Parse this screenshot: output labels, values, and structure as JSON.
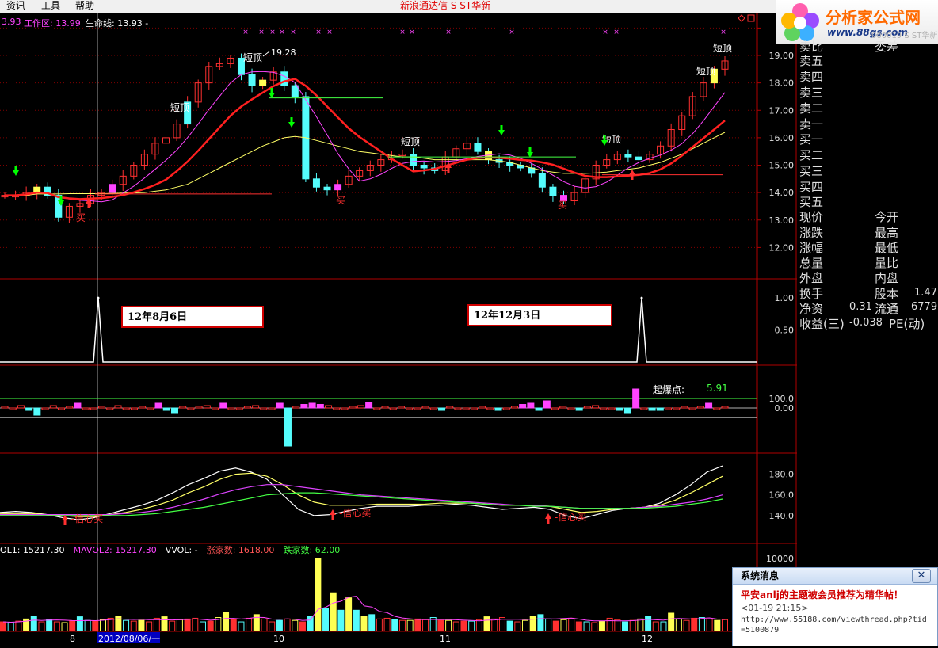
{
  "menu": {
    "items": [
      "资讯",
      "工具",
      "帮助"
    ],
    "title": "新浪通达信  S ST华新"
  },
  "logo": {
    "brand": "分析家公式网",
    "url": "www.88gs.com",
    "overlay": "000019 S ST华新"
  },
  "indicators": {
    "price_prefix": "3.93",
    "work_label": "工作区: 13.99",
    "life_label": "生命线: 13.93 -",
    "vol_items": [
      {
        "text": "OL1: 15217.30",
        "color": "#ffffff"
      },
      {
        "text": "MAVOL2: 15217.30",
        "color": "#ff44ff"
      },
      {
        "text": "VVOL: -",
        "color": "#ffffff"
      },
      {
        "text": "涨家数: 1618.00",
        "color": "#ff5555"
      },
      {
        "text": "跌家数: 62.00",
        "color": "#44ff44"
      }
    ]
  },
  "chart_annotations": {
    "high_price": "19.28",
    "short_top": "短顶",
    "buy": "买",
    "confidence_buy": "信心买",
    "callout_left": "12年8月6日",
    "callout_right": "12年12月3日",
    "burst_label": "起爆点:",
    "burst_value": "5.91"
  },
  "axis": {
    "price_ticks": [
      "20",
      "19.00",
      "18.00",
      "17.00",
      "16.00",
      "15.00",
      "14.00",
      "13.00",
      "12.00"
    ],
    "signal_ticks": [
      "1.00",
      "0.50"
    ],
    "osc_ticks": [
      "100.0",
      "0.00"
    ],
    "ma_ticks": [
      "180.0",
      "160.0",
      "140.0"
    ],
    "vol_ticks": [
      "10000"
    ],
    "date_labels": [
      "8",
      "2012/08/06/一",
      "10",
      "11",
      "12"
    ]
  },
  "sidebar": {
    "header_partial": [
      "卖比",
      "委差"
    ],
    "sell_levels": [
      "卖五",
      "卖四",
      "卖三",
      "卖二",
      "卖一"
    ],
    "buy_levels": [
      "买一",
      "买二",
      "买三",
      "买四",
      "买五"
    ],
    "stats_left": [
      "现价",
      "涨跌",
      "涨幅",
      "总量",
      "外盘",
      "换手",
      "净资",
      "收益(三)"
    ],
    "stats_right": [
      "今开",
      "最高",
      "最低",
      "量比",
      "内盘",
      "股本",
      "流通",
      "PE(动)"
    ],
    "values": {
      "turnover_equity": "1.47",
      "net_asset": "0.31",
      "float": "6779",
      "eps": "-0.038"
    }
  },
  "popup": {
    "title": "系统消息",
    "headline": "平安anlj的主题被会员推荐为精华帖！",
    "time": "<01-19 21:15>",
    "link": "http://www.55188.com/viewthread.php?tid=5100879"
  },
  "colors": {
    "up": "#ff3030",
    "down": "#54fcfc",
    "magenta": "#ff44ff",
    "yellow": "#ffff54",
    "grid": "#800000",
    "green_arrow": "#00ff00"
  },
  "chart_data": [
    {
      "type": "candlestick",
      "title": "",
      "ylim": [
        11.0,
        20.3
      ],
      "series": [
        {
          "name": "price_close",
          "values": [
            13.9,
            13.9,
            14.0,
            14.2,
            13.9,
            13.1,
            13.5,
            13.6,
            13.9,
            14.0,
            14.3,
            14.6,
            15.0,
            15.4,
            15.8,
            16.0,
            16.5,
            17.3,
            18.0,
            18.6,
            18.7,
            18.9,
            18.3,
            17.9,
            18.1,
            18.4,
            17.9,
            17.5,
            14.5,
            14.2,
            14.1,
            14.3,
            14.6,
            14.8,
            15.0,
            15.2,
            15.4,
            15.4,
            15.0,
            14.9,
            14.8,
            15.3,
            15.6,
            15.8,
            15.5,
            15.2,
            15.1,
            15.0,
            14.9,
            14.7,
            14.2,
            13.9,
            13.7,
            14.0,
            14.5,
            15.0,
            15.2,
            15.4,
            15.3,
            15.2,
            15.4,
            15.7,
            16.3,
            16.8,
            17.5,
            18.0,
            18.5,
            18.8
          ]
        },
        {
          "name": "life_line",
          "values": [
            13.9,
            13.9,
            13.9,
            13.95,
            13.95,
            13.95,
            13.96,
            13.96,
            13.96,
            13.96,
            13.97,
            13.98,
            13.99,
            14.0,
            14.05,
            14.1,
            14.2,
            14.3,
            14.5,
            14.7,
            14.9,
            15.1,
            15.3,
            15.5,
            15.7,
            15.85,
            16.0,
            16.05,
            16.0,
            15.9,
            15.8,
            15.7,
            15.6,
            15.5,
            15.45,
            15.4,
            15.35,
            15.3,
            15.3,
            15.25,
            15.2,
            15.2,
            15.2,
            15.2,
            15.2,
            15.2,
            15.15,
            15.1,
            15.0,
            14.9,
            14.8,
            14.75,
            14.7,
            14.7,
            14.7,
            14.72,
            14.75,
            14.8,
            14.85,
            14.9,
            15.0,
            15.1,
            15.25,
            15.4,
            15.6,
            15.8,
            16.0,
            16.2
          ]
        }
      ]
    },
    {
      "type": "line",
      "title": "",
      "ylim": [
        0,
        1.15
      ],
      "x": [
        "2012-08-06",
        "2012-12-03"
      ],
      "values": [
        1.0,
        1.0
      ]
    },
    {
      "type": "bar",
      "title": "",
      "ylim": [
        -180,
        110
      ],
      "values": [
        5,
        -5,
        10,
        -10,
        -30,
        -5,
        10,
        -5,
        5,
        20,
        -5,
        -5,
        5,
        -5,
        10,
        -5,
        -5,
        5,
        -5,
        20,
        -10,
        -20,
        5,
        -5,
        5,
        10,
        -5,
        20,
        -5,
        -5,
        5,
        10,
        -5,
        -5,
        20,
        -160,
        5,
        15,
        20,
        15,
        10,
        -5,
        -5,
        5,
        10,
        25,
        -5,
        5,
        -5,
        5,
        -5,
        -5,
        5,
        -5,
        -10,
        5,
        -5,
        -5,
        -5,
        5,
        -5,
        -10,
        -5,
        5,
        15,
        20,
        -10,
        30,
        -5,
        5,
        -5,
        -10,
        5,
        10,
        -5,
        -5,
        -10,
        -20,
        80,
        -5,
        -10,
        -10,
        -5,
        -5,
        5,
        -5,
        5,
        20,
        -5,
        5
      ],
      "annotation": "起爆点: 5.91"
    },
    {
      "type": "line",
      "title": "",
      "ylim": [
        120,
        195
      ],
      "series": [
        {
          "name": "white",
          "values": [
            143,
            144,
            143,
            141,
            138,
            136,
            138,
            142,
            146,
            150,
            155,
            162,
            170,
            176,
            183,
            186,
            182,
            175,
            160,
            146,
            140,
            141,
            144,
            147,
            149,
            149,
            149,
            150,
            150,
            151,
            150,
            148,
            146,
            147,
            148,
            146,
            140,
            137,
            141,
            145,
            147,
            148,
            152,
            160,
            170,
            182,
            188
          ]
        },
        {
          "name": "yellow",
          "values": [
            142,
            142,
            142,
            141,
            140,
            139,
            139,
            141,
            143,
            146,
            150,
            155,
            162,
            168,
            175,
            180,
            181,
            178,
            170,
            160,
            153,
            150,
            150,
            150,
            151,
            151,
            151,
            151,
            152,
            152,
            152,
            151,
            150,
            150,
            150,
            149,
            146,
            143,
            144,
            146,
            147,
            148,
            150,
            155,
            162,
            170,
            178
          ]
        },
        {
          "name": "magenta",
          "values": [
            141,
            141,
            141,
            141,
            141,
            141,
            141,
            141,
            142,
            143,
            145,
            148,
            152,
            156,
            161,
            165,
            168,
            170,
            170,
            168,
            166,
            164,
            162,
            160,
            159,
            158,
            157,
            156,
            155,
            154,
            153,
            152,
            151,
            150,
            150,
            149,
            148,
            147,
            147,
            147,
            147,
            148,
            149,
            151,
            153,
            156,
            160
          ]
        },
        {
          "name": "green",
          "values": [
            140,
            140,
            140,
            140,
            140,
            140,
            140,
            140,
            140,
            141,
            142,
            144,
            146,
            148,
            151,
            154,
            157,
            160,
            161,
            162,
            162,
            161,
            160,
            159,
            158,
            157,
            156,
            155,
            154,
            153,
            152,
            151,
            150,
            150,
            149,
            149,
            148,
            147,
            147,
            147,
            147,
            147,
            148,
            149,
            151,
            153,
            156
          ]
        }
      ]
    },
    {
      "type": "bar",
      "title": "",
      "ylim": [
        0,
        12000
      ],
      "values": [
        1300,
        1200,
        1400,
        1700,
        2100,
        1300,
        1600,
        1300,
        1200,
        1400,
        2000,
        1500,
        1400,
        1600,
        1800,
        2100,
        1500,
        1400,
        1500,
        1300,
        1800,
        2000,
        1400,
        1600,
        1700,
        1800,
        1300,
        1400,
        1900,
        2600,
        1700,
        1300,
        1800,
        2300,
        1700,
        1300,
        1500,
        1700,
        1500,
        1300,
        2100,
        10000,
        3200,
        5300,
        2900,
        4600,
        2900,
        2100,
        2300,
        1700,
        1800,
        1600,
        1500,
        1500,
        1700,
        1600,
        1900,
        1500,
        1500,
        1300,
        1400,
        1400,
        1600,
        2000,
        1700,
        1900,
        1400,
        1300,
        1500,
        2100,
        2300,
        1700,
        1400,
        1600,
        1800,
        1300,
        1300,
        1200,
        1400,
        1800,
        1600,
        1300,
        1500,
        1700,
        2100,
        1300,
        1300,
        2500,
        1700,
        1500,
        1800,
        1900,
        1700,
        1500,
        1600
      ]
    }
  ]
}
